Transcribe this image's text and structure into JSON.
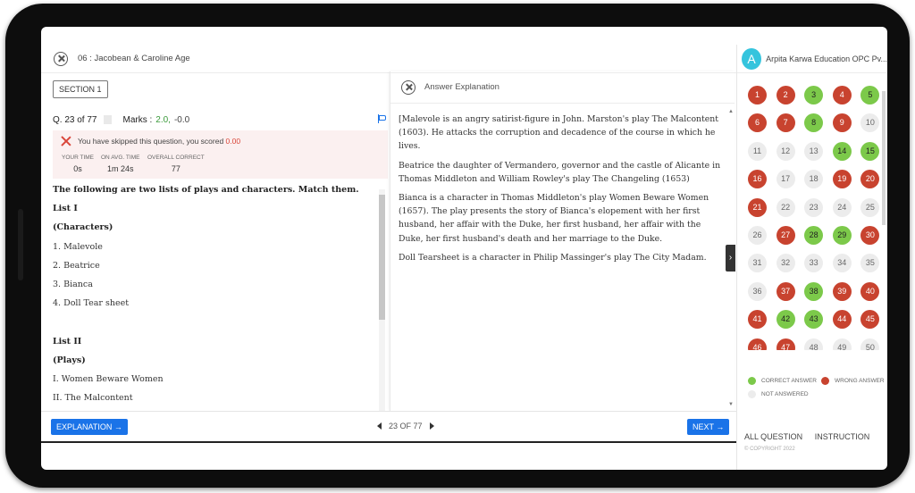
{
  "header": {
    "test_title": "06 : Jacobean & Caroline Age"
  },
  "section": {
    "label": "SECTION 1"
  },
  "question": {
    "number_label": "Q. 23 of 77",
    "marks_label": "Marks :",
    "marks_positive": "2.0,",
    "marks_negative": "-0.0",
    "skip_text": "You have skipped this question, you scored ",
    "skip_score": "0.00",
    "stats": [
      {
        "label": "YOUR TIME",
        "value": "0s"
      },
      {
        "label": "ON AVG. TIME",
        "value": "1m 24s"
      },
      {
        "label": "OVERALL CORRECT",
        "value": "77"
      }
    ],
    "lines": [
      {
        "text": "The following are two lists of plays and characters. Match them.",
        "bold": true
      },
      {
        "text": "List I",
        "bold": true
      },
      {
        "text": "(Characters)",
        "bold": true
      },
      {
        "text": "1. Malevole",
        "bold": false
      },
      {
        "text": "2. Beatrice",
        "bold": false
      },
      {
        "text": "3. Bianca",
        "bold": false
      },
      {
        "text": "4. Doll Tear sheet",
        "bold": false
      },
      {
        "text": "",
        "bold": false
      },
      {
        "text": "List II",
        "bold": true
      },
      {
        "text": "(Plays)",
        "bold": true
      },
      {
        "text": "I. Women Beware Women",
        "bold": false
      },
      {
        "text": "II. The Malcontent",
        "bold": false
      }
    ]
  },
  "explanation": {
    "title": "Answer Explanation",
    "paragraphs": [
      "[Malevole is an angry satirist-figure in John. Marston's play The Malcontent (1603). He attacks the corruption and decadence of the course in which he lives.",
      "Beatrice the daughter of Vermandero, governor and the castle of Alicante in Thomas Middleton and William Rowley's play The Changeling (1653)",
      "Bianca is a character in Thomas Middleton's play Women Beware Women (1657). The play presents the story of Bianca's elopement with her first husband, her affair with the Duke, her first husband, her affair with the Duke, her first husband's death and her marriage to the Duke.",
      "Doll Tearsheet is a character in Philip Massinger's play The City Madam."
    ]
  },
  "footer": {
    "explanation_btn": "EXPLANATION →",
    "pager": "23 OF 77",
    "next_btn": "NEXT →"
  },
  "sidebar": {
    "avatar_letter": "A",
    "org_name": "Arpita Karwa Education OPC Pv...",
    "legend": {
      "correct": "CORRECT ANSWER",
      "wrong": "WRONG ANSWER",
      "not_answered": "NOT ANSWERED"
    },
    "links": [
      "ALL QUESTION",
      "INSTRUCTION"
    ],
    "copyright": "© COPYRIGHT 2022",
    "colors": {
      "correct": "#7cc94a",
      "wrong": "#c8432f",
      "not_answered": "#ececec",
      "accent": "#1a73e8"
    },
    "statuses": [
      "w",
      "w",
      "c",
      "w",
      "c",
      "w",
      "w",
      "c",
      "w",
      "n",
      "n",
      "n",
      "n",
      "c",
      "c",
      "w",
      "n",
      "n",
      "w",
      "w",
      "w",
      "n",
      "n",
      "n",
      "n",
      "n",
      "w",
      "c",
      "c",
      "w",
      "n",
      "n",
      "n",
      "n",
      "n",
      "n",
      "w",
      "c",
      "w",
      "w",
      "w",
      "c",
      "c",
      "w",
      "w",
      "w",
      "w",
      "n",
      "n",
      "n"
    ]
  }
}
